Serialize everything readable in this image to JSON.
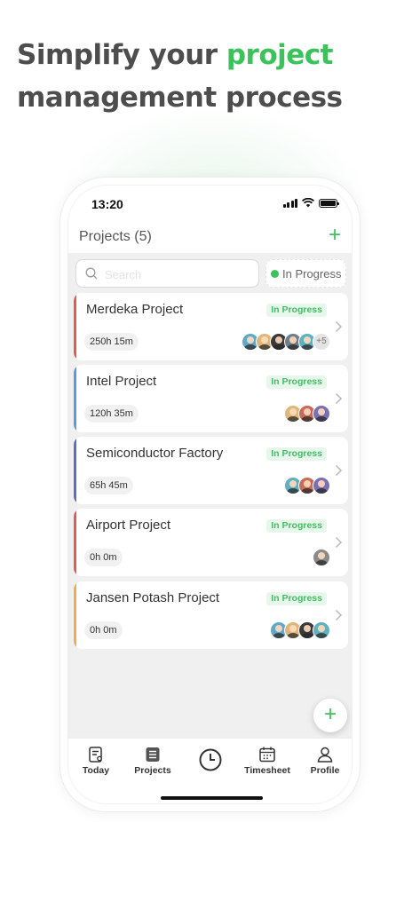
{
  "headline": {
    "line1": "Simplify your ",
    "accent": "project",
    "line2": "management process"
  },
  "colors": {
    "accent": "#3cc25a",
    "headline": "#4d4d4d"
  },
  "status_bar": {
    "time": "13:20"
  },
  "header": {
    "title": "Projects (5)",
    "add_icon": "+"
  },
  "search": {
    "placeholder": "Search"
  },
  "filter": {
    "label": "In Progress"
  },
  "projects": [
    {
      "name": "Merdeka Project",
      "status": "In Progress",
      "hours": "250h 15m",
      "bar_color": "#e25b4f",
      "extra_members": "+5"
    },
    {
      "name": "Intel Project",
      "status": "In Progress",
      "hours": "120h 35m",
      "bar_color": "#5b9bd9"
    },
    {
      "name": "Semiconductor Factory",
      "status": "In Progress",
      "hours": "65h 45m",
      "bar_color": "#5a6fbf"
    },
    {
      "name": "Airport Project",
      "status": "In Progress",
      "hours": "0h 0m",
      "bar_color": "#e25b4f"
    },
    {
      "name": "Jansen Potash Project",
      "status": "In Progress",
      "hours": "0h 0m",
      "bar_color": "#efae4e"
    }
  ],
  "fab": {
    "icon": "+"
  },
  "tabs": [
    {
      "label": "Today",
      "icon": "today-icon"
    },
    {
      "label": "Projects",
      "icon": "projects-icon"
    },
    {
      "label": "",
      "icon": "clock-icon"
    },
    {
      "label": "Timesheet",
      "icon": "calendar-icon"
    },
    {
      "label": "Profile",
      "icon": "person-icon"
    }
  ]
}
